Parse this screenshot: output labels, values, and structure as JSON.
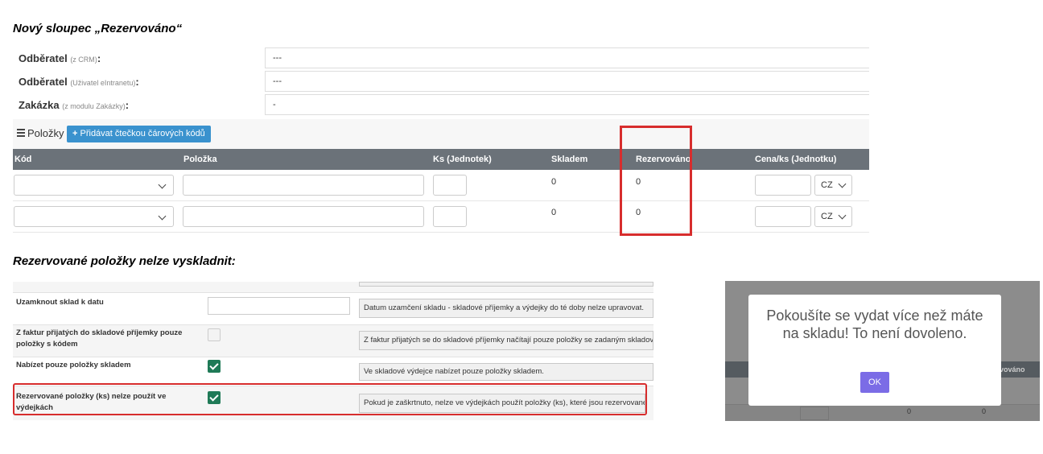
{
  "headings": {
    "new_column": "Nový sloupec „Rezervováno“",
    "reserved_rule": "Rezervované položky nelze vyskladnit:"
  },
  "form": {
    "rows": [
      {
        "label": "Odběratel",
        "hint": "(z CRM)",
        "colon": ":",
        "value": "---"
      },
      {
        "label": "Odběratel",
        "hint": "(Uživatel eIntranetu)",
        "colon": ":",
        "value": "---"
      },
      {
        "label": "Zakázka",
        "hint": "(z modulu Zakázky)",
        "colon": ":",
        "value": "-"
      }
    ]
  },
  "items": {
    "section_label": "Položky",
    "barcode_button": "Přidávat čtečkou čárových kódů",
    "columns": {
      "code": "Kód",
      "item": "Položka",
      "qty": "Ks (Jednotek)",
      "stock": "Skladem",
      "reserved": "Rezervováno",
      "price": "Cena/ks (Jednotku)"
    },
    "rows": [
      {
        "stock": "0",
        "reserved": "0",
        "currency": "CZ"
      },
      {
        "stock": "0",
        "reserved": "0",
        "currency": "CZ"
      }
    ]
  },
  "settings": {
    "rows": [
      {
        "label": "Uzamknout sklad k datu",
        "desc": "Datum uzamčení skladu - skladové příjemky a výdejky do té doby nelze upravovat."
      },
      {
        "label": "Z faktur přijatých do skladové příjemky pouze položky s kódem",
        "desc": "Z faktur přijatých se do skladové příjemky načítají pouze položky se zadaným skladovým"
      },
      {
        "label": "Nabízet pouze položky skladem",
        "desc": "Ve skladové výdejce nabízet pouze položky skladem."
      },
      {
        "label": "Rezervované položky (ks) nelze použít ve výdejkách",
        "desc": "Pokud je zaškrtnuto, nelze ve výdejkách použít položky (ks), které jsou rezervované."
      }
    ]
  },
  "alert": {
    "message": "Pokoušíte se vydat více než máte na skladu! To není dovoleno.",
    "ok_label": "OK",
    "bg_header_fragment": "vováno",
    "bg_values": [
      "0",
      "0"
    ]
  },
  "colors": {
    "accent_red": "#d72d2d",
    "header_gray": "#6b7279",
    "button_blue": "#3a92ce",
    "checkbox_green": "#1f7a57",
    "ok_purple": "#7b6ce6"
  }
}
